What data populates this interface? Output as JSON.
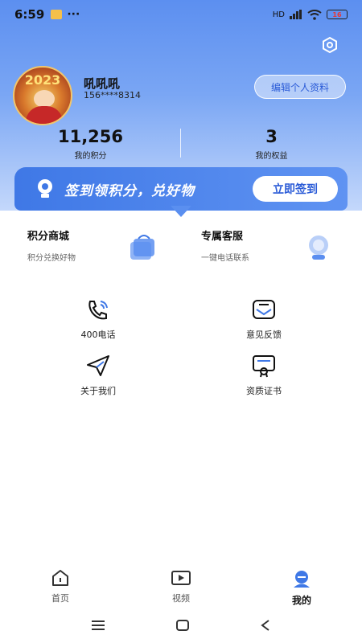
{
  "statusbar": {
    "time": "6:59",
    "dots": "···",
    "network": "HD",
    "battery": "16"
  },
  "profile": {
    "name": "吼吼吼",
    "phone": "156****8314",
    "avatar_year": "2023",
    "edit_label": "编辑个人资料"
  },
  "stats": [
    {
      "value": "11,256",
      "label": "我的积分"
    },
    {
      "value": "3",
      "label": "我的权益"
    }
  ],
  "signin": {
    "text": "签到领积分，兑好物",
    "button": "立即签到"
  },
  "cards": [
    {
      "title": "积分商城",
      "subtitle": "积分兑换好物"
    },
    {
      "title": "专属客服",
      "subtitle": "一键电话联系"
    }
  ],
  "grid": [
    {
      "label": "400电话",
      "icon": "phone-icon"
    },
    {
      "label": "意见反馈",
      "icon": "feedback-icon"
    },
    {
      "label": "关于我们",
      "icon": "send-icon"
    },
    {
      "label": "资质证书",
      "icon": "certificate-icon"
    }
  ],
  "tabs": [
    {
      "label": "首页",
      "icon": "home-icon"
    },
    {
      "label": "视频",
      "icon": "video-icon"
    },
    {
      "label": "我的",
      "icon": "profile-icon",
      "active": true
    }
  ],
  "colors": {
    "primary": "#3f78e6",
    "accent": "#2a5bd7"
  }
}
